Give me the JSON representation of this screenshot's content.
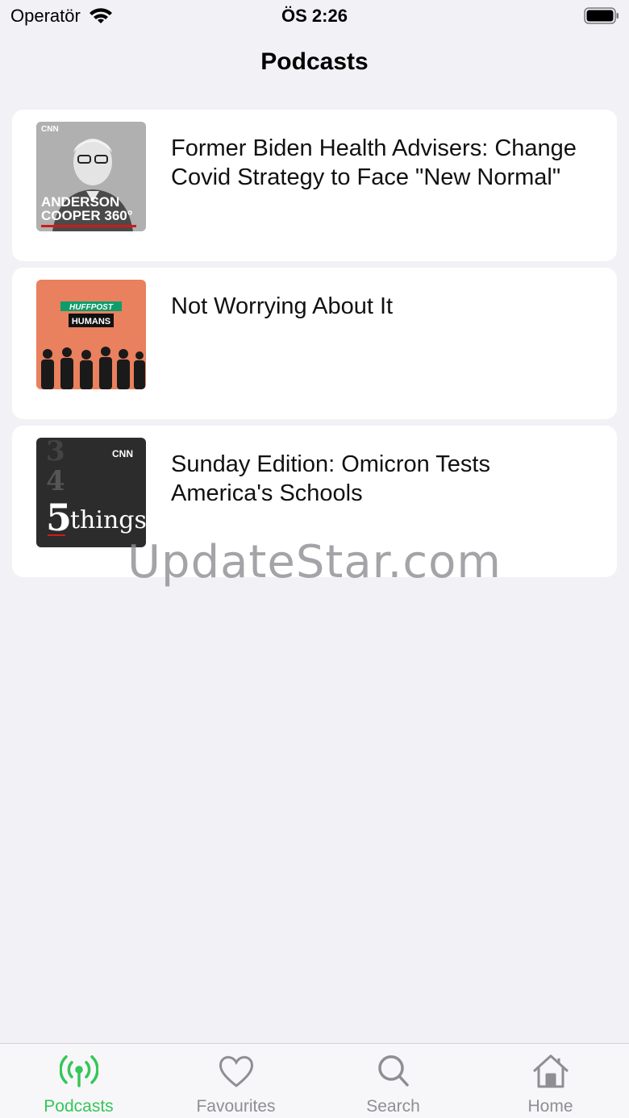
{
  "status_bar": {
    "carrier": "Operatör",
    "time": "ÖS 2:26"
  },
  "nav": {
    "title": "Podcasts"
  },
  "episodes": [
    {
      "title": "Former Biden Health Advisers: Change Covid Strategy to Face \"New Normal\"",
      "artwork": {
        "brand": "CNN",
        "line1": "ANDERSON",
        "line2": "COOPER 360°"
      }
    },
    {
      "title": "Not Worrying About It",
      "artwork": {
        "brand": "HUFFPOST",
        "badge": "HUMANS"
      }
    },
    {
      "title": "Sunday Edition: Omicron Tests America's Schools",
      "artwork": {
        "brand": "CNN",
        "big_number": "5",
        "word": "things",
        "ghost1": "3",
        "ghost2": "4"
      }
    }
  ],
  "watermark": "UpdateStar.com",
  "tabbar": {
    "tabs": [
      {
        "label": "Podcasts",
        "icon": "antenna-icon",
        "active": true
      },
      {
        "label": "Favourites",
        "icon": "heart-icon",
        "active": false
      },
      {
        "label": "Search",
        "icon": "search-icon",
        "active": false
      },
      {
        "label": "Home",
        "icon": "home-icon",
        "active": false
      }
    ]
  },
  "colors": {
    "accent": "#34c759",
    "background": "#f2f1f6",
    "card": "#ffffff",
    "inactive": "#8e8e93"
  }
}
